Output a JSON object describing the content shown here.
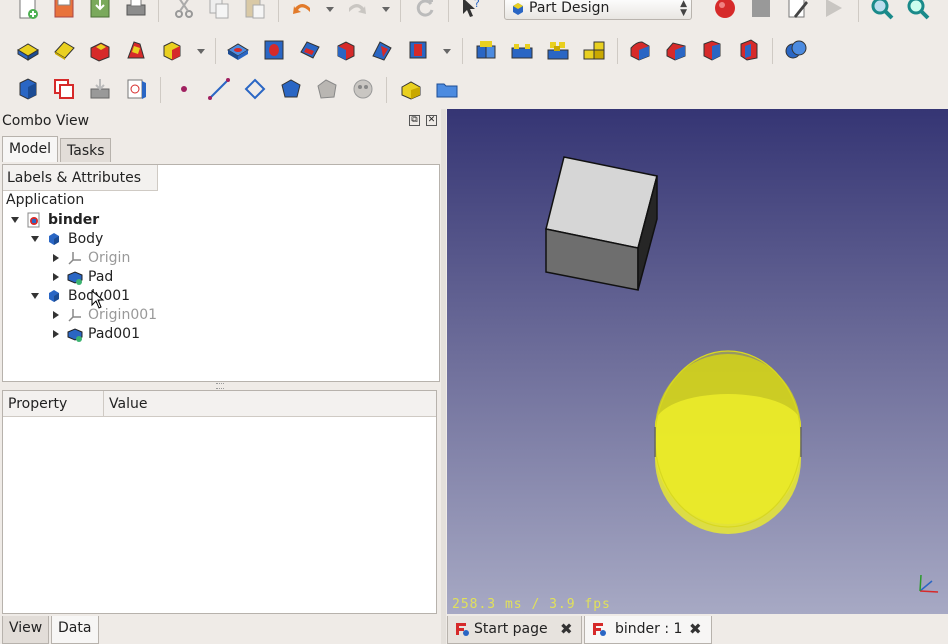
{
  "toolbar": {
    "workbench": "Part Design",
    "colors": {
      "accent_red": "#d62a2a",
      "part_blue": "#2a66c4",
      "part_yellow": "#e9d020"
    }
  },
  "combo_view": {
    "title": "Combo View",
    "tabs": [
      "Model",
      "Tasks"
    ],
    "tree": {
      "column_header": "Labels & Attributes",
      "root_label": "Application",
      "items": [
        {
          "label": "binder",
          "bold": true
        },
        {
          "label": "Body"
        },
        {
          "label": "Origin",
          "grayed": true
        },
        {
          "label": "Pad"
        },
        {
          "label": "Body001"
        },
        {
          "label": "Origin001",
          "grayed": true
        },
        {
          "label": "Pad001"
        }
      ]
    },
    "property": {
      "columns": [
        "Property",
        "Value"
      ]
    },
    "bottom_tabs": [
      "View",
      "Data"
    ]
  },
  "viewport": {
    "fps_text": "258.3 ms / 3.9 fps"
  },
  "document_tabs": [
    {
      "label": "Start page"
    },
    {
      "label": "binder : 1"
    }
  ]
}
